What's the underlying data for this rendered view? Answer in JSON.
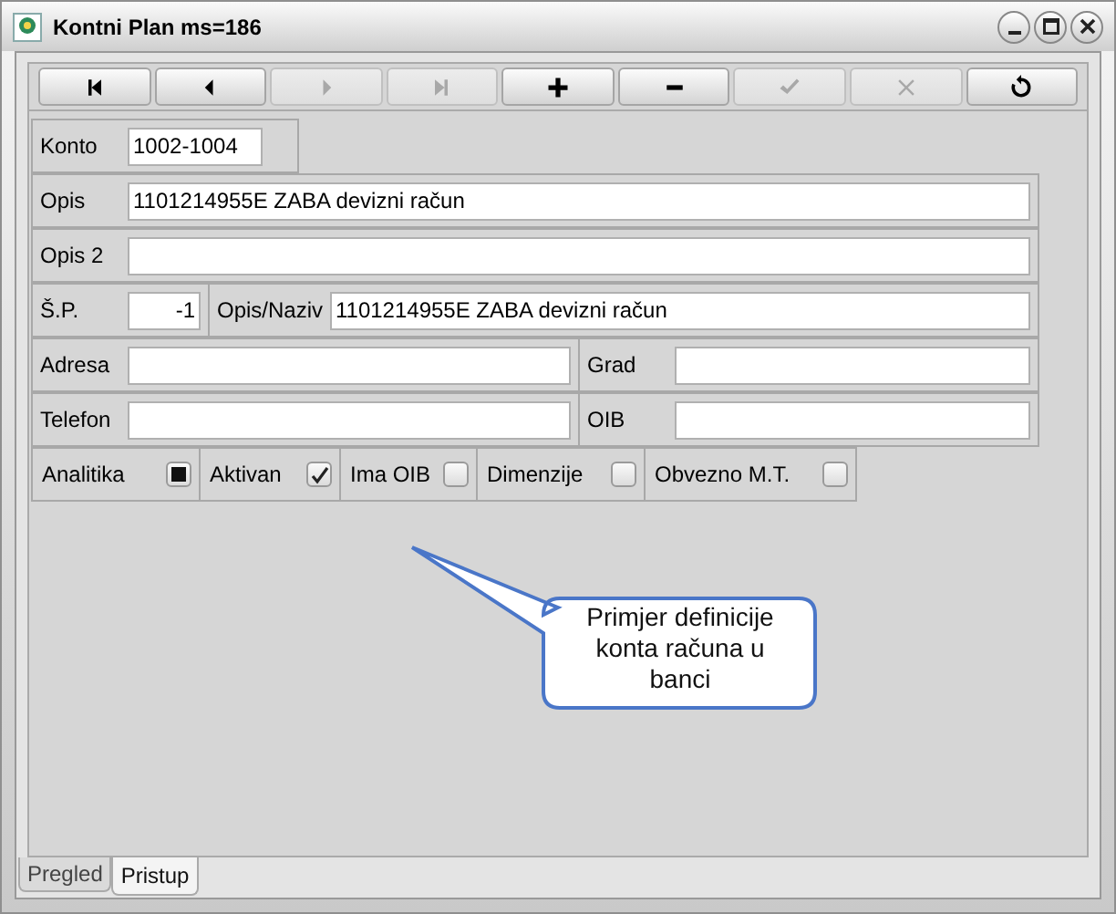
{
  "window": {
    "title": "Kontni Plan ms=186"
  },
  "toolbar": [
    {
      "kind": "first",
      "disabled": false
    },
    {
      "kind": "prev",
      "disabled": false
    },
    {
      "kind": "next",
      "disabled": true
    },
    {
      "kind": "last",
      "disabled": true
    },
    {
      "kind": "add",
      "disabled": false
    },
    {
      "kind": "remove",
      "disabled": false
    },
    {
      "kind": "confirm",
      "disabled": true
    },
    {
      "kind": "cancel",
      "disabled": true
    },
    {
      "kind": "refresh",
      "disabled": false
    }
  ],
  "form": {
    "konto": {
      "label": "Konto",
      "value": "1002-1004"
    },
    "opis": {
      "label": "Opis",
      "value": "1101214955E ZABA devizni račun"
    },
    "opis2": {
      "label": "Opis 2"
    },
    "sp": {
      "label": "Š.P.",
      "value": "-1"
    },
    "naziv": {
      "label": "Opis/Naziv",
      "value": "1101214955E ZABA devizni račun"
    },
    "adresa": {
      "label": "Adresa"
    },
    "grad": {
      "label": "Grad"
    },
    "telefon": {
      "label": "Telefon"
    },
    "oib": {
      "label": "OIB"
    },
    "checkboxes": [
      {
        "label": "Analitika",
        "kind": "square",
        "checked": true
      },
      {
        "label": "Aktivan",
        "kind": "tick",
        "checked": true
      },
      {
        "label": "Ima OIB",
        "checked": false
      },
      {
        "label": "Dimenzije",
        "checked": false
      },
      {
        "label": "Obvezno M.T.",
        "checked": false
      }
    ]
  },
  "callout": {
    "text": "Primjer definicije konta računa u banci"
  },
  "tabs": [
    {
      "label": "Pregled",
      "selected": false
    },
    {
      "label": "Pristup",
      "selected": true
    }
  ]
}
